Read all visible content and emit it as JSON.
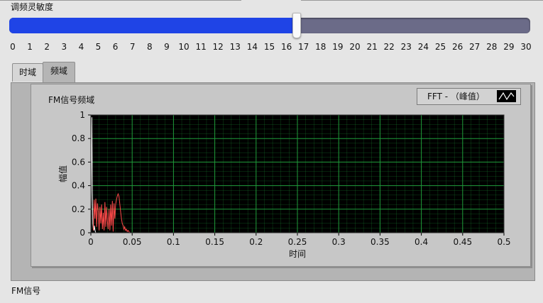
{
  "slider": {
    "label": "调频灵敏度",
    "value": 16.5,
    "min": 0,
    "max": 30,
    "ticks": [
      "0",
      "1",
      "2",
      "3",
      "4",
      "5",
      "6",
      "7",
      "8",
      "9",
      "10",
      "11",
      "12",
      "13",
      "14",
      "15",
      "16",
      "17",
      "18",
      "19",
      "20",
      "21",
      "22",
      "23",
      "24",
      "25",
      "26",
      "27",
      "28",
      "29",
      "30"
    ],
    "fill_color": "#1f44e6",
    "track_color": "#6b6b88"
  },
  "tabs": [
    {
      "label": "时域"
    },
    {
      "label": "频域"
    }
  ],
  "active_tab": 1,
  "graph": {
    "title": "FM信号频域",
    "legend_label": "FFT - （峰值）",
    "plot_bg": "#000000",
    "grid_color": "#1f9a3a"
  },
  "chart_data": {
    "type": "line",
    "xlabel": "时间",
    "ylabel": "幅值",
    "xlim": [
      0,
      0.5
    ],
    "ylim": [
      0,
      1
    ],
    "x_ticks": [
      "0",
      "0.05",
      "0.1",
      "0.15",
      "0.2",
      "0.25",
      "0.3",
      "0.35",
      "0.4",
      "0.45",
      "0.5"
    ],
    "y_ticks": [
      "0",
      "0.2",
      "0.4",
      "0.6",
      "0.8",
      "1"
    ],
    "series": [
      {
        "color": "#ffffff",
        "x": [
          0.0,
          0.0006,
          0.0012,
          0.0018,
          0.0024,
          0.003,
          0.0036,
          0.0042,
          0.0048,
          0.0054,
          0.006
        ],
        "y": [
          0.0,
          0.55,
          0.98,
          0.35,
          0.08,
          0.03,
          0.02,
          0.06,
          0.03,
          0.01,
          0.0
        ]
      },
      {
        "color": "#ff4a4a",
        "x": [
          0.003,
          0.004,
          0.005,
          0.006,
          0.007,
          0.008,
          0.009,
          0.01,
          0.011,
          0.012,
          0.013,
          0.014,
          0.015,
          0.016,
          0.017,
          0.018,
          0.019,
          0.02,
          0.021,
          0.022,
          0.023,
          0.024,
          0.025,
          0.026,
          0.027,
          0.028,
          0.029,
          0.03,
          0.031,
          0.032,
          0.033,
          0.034,
          0.035,
          0.036,
          0.037,
          0.038,
          0.039,
          0.04,
          0.041,
          0.042,
          0.043,
          0.044,
          0.045,
          0.046,
          0.047
        ],
        "y": [
          0.02,
          0.28,
          0.12,
          0.29,
          0.05,
          0.25,
          0.18,
          0.02,
          0.22,
          0.08,
          0.24,
          0.03,
          0.17,
          0.02,
          0.26,
          0.05,
          0.22,
          0.1,
          0.03,
          0.2,
          0.02,
          0.24,
          0.06,
          0.27,
          0.01,
          0.25,
          0.12,
          0.24,
          0.28,
          0.31,
          0.33,
          0.31,
          0.25,
          0.18,
          0.12,
          0.08,
          0.06,
          0.03,
          0.05,
          0.02,
          0.03,
          0.01,
          0.02,
          0.01,
          0.0
        ]
      }
    ]
  },
  "bottom_label": "FM信号"
}
